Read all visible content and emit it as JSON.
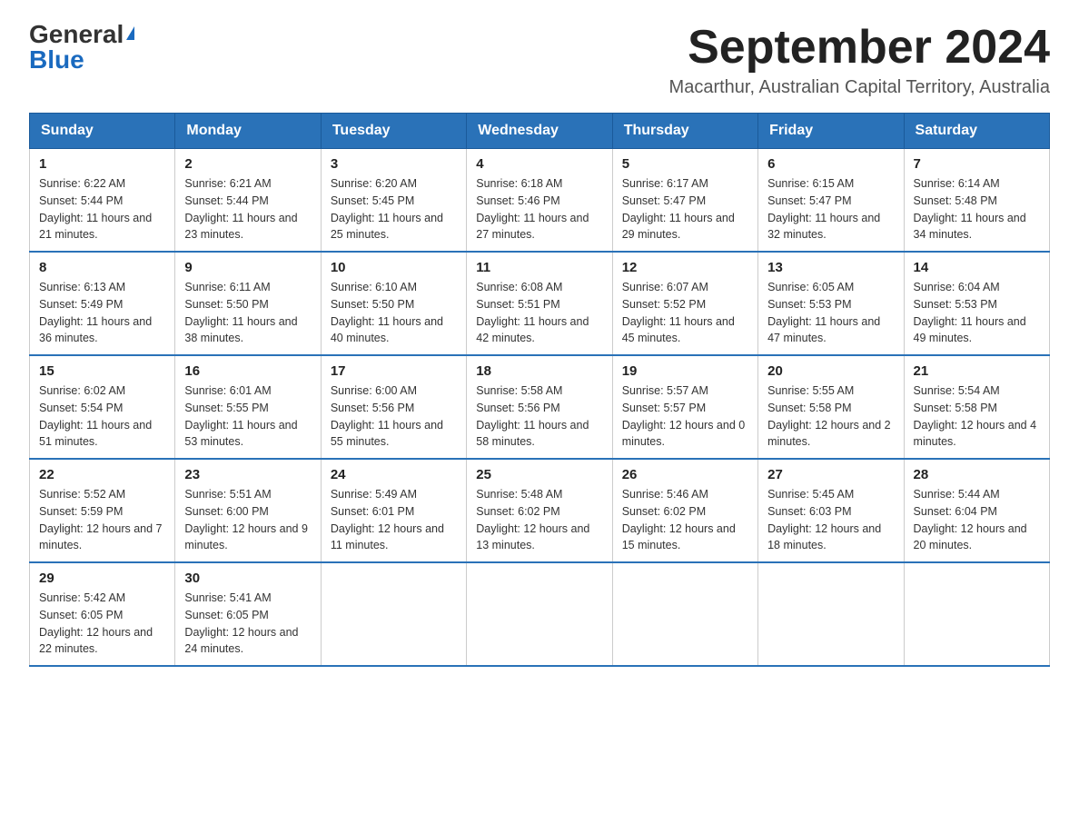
{
  "header": {
    "logo_general": "General",
    "logo_blue": "Blue",
    "month_year": "September 2024",
    "location": "Macarthur, Australian Capital Territory, Australia"
  },
  "calendar": {
    "days_of_week": [
      "Sunday",
      "Monday",
      "Tuesday",
      "Wednesday",
      "Thursday",
      "Friday",
      "Saturday"
    ],
    "weeks": [
      [
        {
          "day": "1",
          "sunrise": "Sunrise: 6:22 AM",
          "sunset": "Sunset: 5:44 PM",
          "daylight": "Daylight: 11 hours and 21 minutes."
        },
        {
          "day": "2",
          "sunrise": "Sunrise: 6:21 AM",
          "sunset": "Sunset: 5:44 PM",
          "daylight": "Daylight: 11 hours and 23 minutes."
        },
        {
          "day": "3",
          "sunrise": "Sunrise: 6:20 AM",
          "sunset": "Sunset: 5:45 PM",
          "daylight": "Daylight: 11 hours and 25 minutes."
        },
        {
          "day": "4",
          "sunrise": "Sunrise: 6:18 AM",
          "sunset": "Sunset: 5:46 PM",
          "daylight": "Daylight: 11 hours and 27 minutes."
        },
        {
          "day": "5",
          "sunrise": "Sunrise: 6:17 AM",
          "sunset": "Sunset: 5:47 PM",
          "daylight": "Daylight: 11 hours and 29 minutes."
        },
        {
          "day": "6",
          "sunrise": "Sunrise: 6:15 AM",
          "sunset": "Sunset: 5:47 PM",
          "daylight": "Daylight: 11 hours and 32 minutes."
        },
        {
          "day": "7",
          "sunrise": "Sunrise: 6:14 AM",
          "sunset": "Sunset: 5:48 PM",
          "daylight": "Daylight: 11 hours and 34 minutes."
        }
      ],
      [
        {
          "day": "8",
          "sunrise": "Sunrise: 6:13 AM",
          "sunset": "Sunset: 5:49 PM",
          "daylight": "Daylight: 11 hours and 36 minutes."
        },
        {
          "day": "9",
          "sunrise": "Sunrise: 6:11 AM",
          "sunset": "Sunset: 5:50 PM",
          "daylight": "Daylight: 11 hours and 38 minutes."
        },
        {
          "day": "10",
          "sunrise": "Sunrise: 6:10 AM",
          "sunset": "Sunset: 5:50 PM",
          "daylight": "Daylight: 11 hours and 40 minutes."
        },
        {
          "day": "11",
          "sunrise": "Sunrise: 6:08 AM",
          "sunset": "Sunset: 5:51 PM",
          "daylight": "Daylight: 11 hours and 42 minutes."
        },
        {
          "day": "12",
          "sunrise": "Sunrise: 6:07 AM",
          "sunset": "Sunset: 5:52 PM",
          "daylight": "Daylight: 11 hours and 45 minutes."
        },
        {
          "day": "13",
          "sunrise": "Sunrise: 6:05 AM",
          "sunset": "Sunset: 5:53 PM",
          "daylight": "Daylight: 11 hours and 47 minutes."
        },
        {
          "day": "14",
          "sunrise": "Sunrise: 6:04 AM",
          "sunset": "Sunset: 5:53 PM",
          "daylight": "Daylight: 11 hours and 49 minutes."
        }
      ],
      [
        {
          "day": "15",
          "sunrise": "Sunrise: 6:02 AM",
          "sunset": "Sunset: 5:54 PM",
          "daylight": "Daylight: 11 hours and 51 minutes."
        },
        {
          "day": "16",
          "sunrise": "Sunrise: 6:01 AM",
          "sunset": "Sunset: 5:55 PM",
          "daylight": "Daylight: 11 hours and 53 minutes."
        },
        {
          "day": "17",
          "sunrise": "Sunrise: 6:00 AM",
          "sunset": "Sunset: 5:56 PM",
          "daylight": "Daylight: 11 hours and 55 minutes."
        },
        {
          "day": "18",
          "sunrise": "Sunrise: 5:58 AM",
          "sunset": "Sunset: 5:56 PM",
          "daylight": "Daylight: 11 hours and 58 minutes."
        },
        {
          "day": "19",
          "sunrise": "Sunrise: 5:57 AM",
          "sunset": "Sunset: 5:57 PM",
          "daylight": "Daylight: 12 hours and 0 minutes."
        },
        {
          "day": "20",
          "sunrise": "Sunrise: 5:55 AM",
          "sunset": "Sunset: 5:58 PM",
          "daylight": "Daylight: 12 hours and 2 minutes."
        },
        {
          "day": "21",
          "sunrise": "Sunrise: 5:54 AM",
          "sunset": "Sunset: 5:58 PM",
          "daylight": "Daylight: 12 hours and 4 minutes."
        }
      ],
      [
        {
          "day": "22",
          "sunrise": "Sunrise: 5:52 AM",
          "sunset": "Sunset: 5:59 PM",
          "daylight": "Daylight: 12 hours and 7 minutes."
        },
        {
          "day": "23",
          "sunrise": "Sunrise: 5:51 AM",
          "sunset": "Sunset: 6:00 PM",
          "daylight": "Daylight: 12 hours and 9 minutes."
        },
        {
          "day": "24",
          "sunrise": "Sunrise: 5:49 AM",
          "sunset": "Sunset: 6:01 PM",
          "daylight": "Daylight: 12 hours and 11 minutes."
        },
        {
          "day": "25",
          "sunrise": "Sunrise: 5:48 AM",
          "sunset": "Sunset: 6:02 PM",
          "daylight": "Daylight: 12 hours and 13 minutes."
        },
        {
          "day": "26",
          "sunrise": "Sunrise: 5:46 AM",
          "sunset": "Sunset: 6:02 PM",
          "daylight": "Daylight: 12 hours and 15 minutes."
        },
        {
          "day": "27",
          "sunrise": "Sunrise: 5:45 AM",
          "sunset": "Sunset: 6:03 PM",
          "daylight": "Daylight: 12 hours and 18 minutes."
        },
        {
          "day": "28",
          "sunrise": "Sunrise: 5:44 AM",
          "sunset": "Sunset: 6:04 PM",
          "daylight": "Daylight: 12 hours and 20 minutes."
        }
      ],
      [
        {
          "day": "29",
          "sunrise": "Sunrise: 5:42 AM",
          "sunset": "Sunset: 6:05 PM",
          "daylight": "Daylight: 12 hours and 22 minutes."
        },
        {
          "day": "30",
          "sunrise": "Sunrise: 5:41 AM",
          "sunset": "Sunset: 6:05 PM",
          "daylight": "Daylight: 12 hours and 24 minutes."
        },
        null,
        null,
        null,
        null,
        null
      ]
    ]
  }
}
